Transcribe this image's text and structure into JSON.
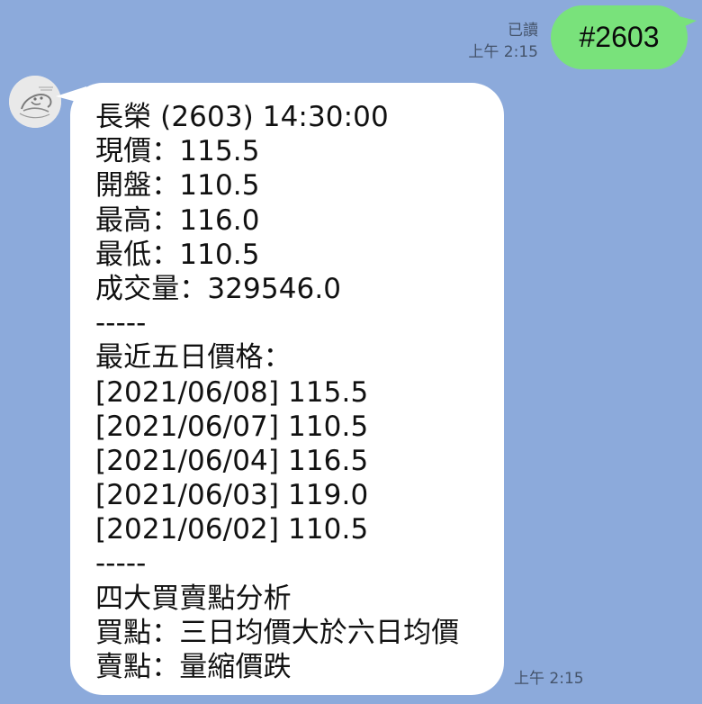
{
  "chat": {
    "sent_message": {
      "text": "#2603",
      "read_status": "已讀",
      "time": "上午 2:15"
    },
    "received_message": {
      "lines": [
        "長榮 (2603) 14:30:00",
        "現價：115.5",
        "開盤：110.5",
        "最高：116.0",
        "最低：110.5",
        "成交量：329546.0",
        "-----",
        "最近五日價格：",
        "[2021/06/08] 115.5",
        "[2021/06/07] 110.5",
        "[2021/06/04] 116.5",
        "[2021/06/03] 119.0",
        "[2021/06/02] 110.5",
        "-----",
        "四大買賣點分析",
        "買點：三日均價大於六日均價",
        "賣點：量縮價跌"
      ],
      "time": "上午 2:15"
    }
  },
  "colors": {
    "background": "#8caadb",
    "sent_bubble": "#79e27b",
    "received_bubble": "#ffffff",
    "meta_text": "#44536a"
  },
  "icons": {
    "avatar": "bot-avatar-sketch-icon"
  }
}
